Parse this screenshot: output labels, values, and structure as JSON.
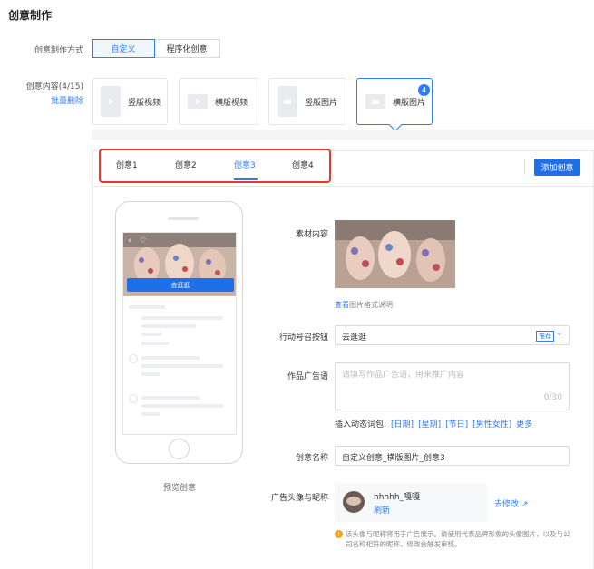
{
  "section_title": "创意制作",
  "method": {
    "label": "创意制作方式",
    "options": [
      "自定义",
      "程序化创意"
    ],
    "selected": "自定义"
  },
  "content": {
    "label": "创意内容(4/15)",
    "batch_delete": "批量删除",
    "types": [
      {
        "name": "竖版视频",
        "icon": "video-icon"
      },
      {
        "name": "横版视频",
        "icon": "video-icon"
      },
      {
        "name": "竖版图片",
        "icon": "image-icon"
      },
      {
        "name": "横版图片",
        "icon": "image-icon",
        "badge": "4",
        "selected": true
      }
    ]
  },
  "tabs": [
    "创意1",
    "创意2",
    "创意3",
    "创意4"
  ],
  "active_tab": "创意3",
  "add_button": "添加创意",
  "preview": {
    "cta": "去逛逛",
    "caption": "预览创意"
  },
  "form": {
    "material_label": "素材内容",
    "material_link": "查看",
    "material_note": "图片格式说明",
    "cta_label": "行动号召按钮",
    "cta_value": "去逛逛",
    "cta_tag": "推荐",
    "ad_copy_label": "作品广告语",
    "ad_copy_placeholder": "请填写作品广告语，用来推广内容",
    "ad_copy_count": "0/30",
    "insert_label": "插入动态词包:",
    "insert_words": [
      "[日期]",
      "[星期]",
      "[节日]",
      "[男性女性]",
      "更多"
    ],
    "name_label": "创意名称",
    "name_value": "自定义创意_横版图片_创意3",
    "avatar_label": "广告头像与昵称",
    "nickname": "hhhhh_嘎嘎",
    "refresh": "刷新",
    "edit_link": "去修改",
    "notice": "该头像与昵称将用于广告展示。请使用代表品牌形象的头像图片，以及与公司名称相符的昵称，修改会触发审核。"
  },
  "colors": {
    "accent": "#2b7cff",
    "highlight_box": "#e8382b"
  }
}
